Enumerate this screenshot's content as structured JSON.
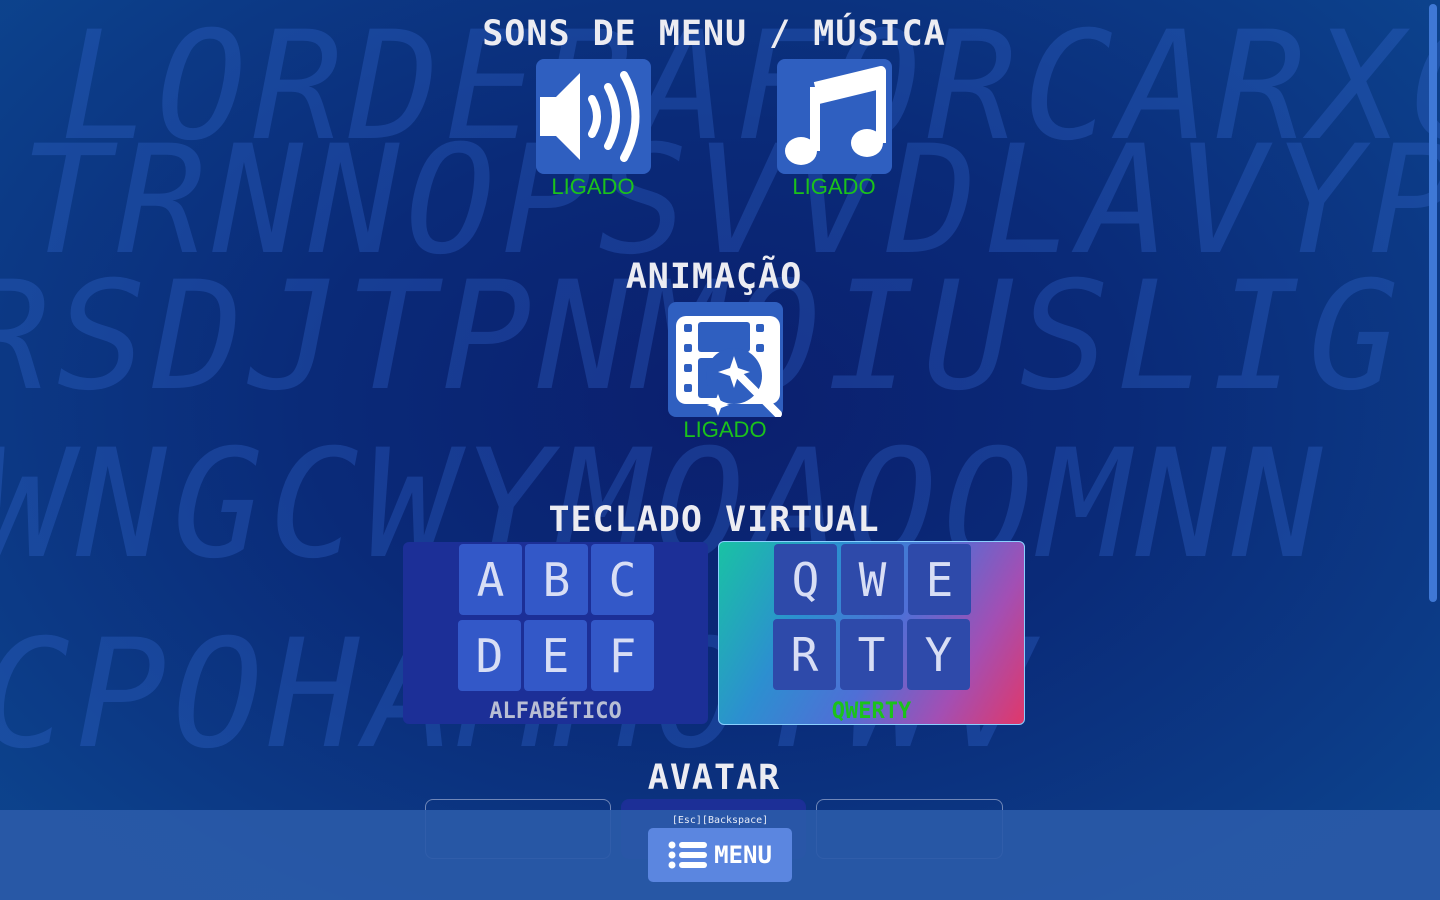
{
  "background_letters": [
    "LORDEBAFORCARXCS",
    "TRNNOPSVVDLAVYPY",
    "RSDJTPNMOIUSLIG",
    "WNGCWYMOAQOMNN",
    "CPOHAMMOYWV"
  ],
  "sections": {
    "sounds": {
      "title": "SONS DE MENU / MÚSICA",
      "menu_sounds_status": "LIGADO",
      "music_status": "LIGADO"
    },
    "animation": {
      "title": "ANIMAÇÃO",
      "status": "LIGADO"
    },
    "keyboard": {
      "title": "TECLADO VIRTUAL",
      "alphabetic": {
        "keys": [
          "A",
          "B",
          "C",
          "D",
          "E",
          "F"
        ],
        "label": "ALFABÉTICO"
      },
      "qwerty": {
        "keys": [
          "Q",
          "W",
          "E",
          "R",
          "T",
          "Y"
        ],
        "label": "QWERTY"
      }
    },
    "avatar": {
      "title": "AVATAR"
    }
  },
  "footer": {
    "hint": "[Esc][Backspace]",
    "menu_label": "MENU"
  },
  "colors": {
    "status_on": "#1bc21b",
    "label_inactive": "#b9bfd4",
    "tile": "#2f5fc0"
  },
  "icons": {
    "menu_sounds": "speaker-icon",
    "music": "music-note-icon",
    "animation": "film-magic-wand-icon",
    "menu": "list-icon"
  }
}
